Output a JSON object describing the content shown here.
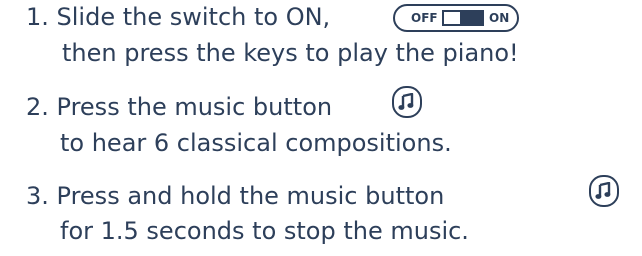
{
  "instructions": {
    "step1_line1": "1. Slide the switch to ON,",
    "step1_line2": "then press the keys to play the piano!",
    "step2_line1": "2. Press the music button",
    "step2_line2": "to hear 6 classical compositions.",
    "step3_line1": "3. Press and hold the music button",
    "step3_line2": "for 1.5 seconds to stop the music."
  },
  "switch": {
    "off_label": "OFF",
    "on_label": "ON",
    "state": "on"
  },
  "icons": {
    "music_button": "music-note-icon",
    "switch": "toggle-switch-icon"
  },
  "colors": {
    "text": "#2d3f5a",
    "background": "#ffffff"
  }
}
